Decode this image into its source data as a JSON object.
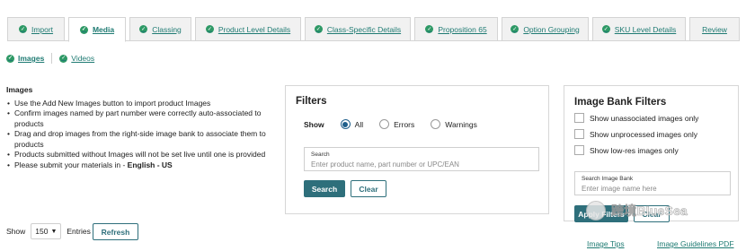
{
  "tabs": [
    {
      "label": "Import",
      "active": false
    },
    {
      "label": "Media",
      "active": true
    },
    {
      "label": "Classing",
      "active": false
    },
    {
      "label": "Product Level Details",
      "active": false
    },
    {
      "label": "Class-Specific Details",
      "active": false
    },
    {
      "label": "Proposition 65",
      "active": false
    },
    {
      "label": "Option Grouping",
      "active": false
    },
    {
      "label": "SKU Level Details",
      "active": false
    },
    {
      "label": "Review",
      "active": false
    }
  ],
  "subtabs": [
    {
      "label": "Images",
      "active": true
    },
    {
      "label": "Videos",
      "active": false
    }
  ],
  "instructions": {
    "title": "Images",
    "items": [
      "Use the Add New Images button to import product Images",
      "Confirm images named by part number were correctly auto-associated to products",
      "Drag and drop images from the right-side image bank to associate them to products",
      "Products submitted without Images will not be set live until one is provided",
      "Please submit your materials in - "
    ],
    "language": "English - US"
  },
  "filters": {
    "title": "Filters",
    "show_label": "Show",
    "options": [
      "All",
      "Errors",
      "Warnings"
    ],
    "selected": "All",
    "search_label": "Search",
    "search_placeholder": "Enter product name, part number or UPC/EAN",
    "search_button": "Search",
    "clear_button": "Clear"
  },
  "image_bank": {
    "title": "Image Bank Filters",
    "checkboxes": [
      "Show unassociated images only",
      "Show unprocessed images only",
      "Show low-res images only"
    ],
    "search_label": "Search Image Bank",
    "search_placeholder": "Enter image name here",
    "filter_button": "Apply Filters",
    "clear_button": "Clear"
  },
  "table_controls": {
    "show_label": "Show",
    "entries_value": "150",
    "entries_label": "Entries",
    "refresh_button": "Refresh"
  },
  "links": {
    "image_tips": "Image Tips",
    "image_guidelines": "Image Guidelines PDF"
  },
  "watermark": {
    "text": "跨境BlueSea"
  },
  "colors": {
    "accent": "#1f7b73",
    "check": "#2e9966",
    "button": "#2e6f7b",
    "radio": "#1f5f8b"
  }
}
